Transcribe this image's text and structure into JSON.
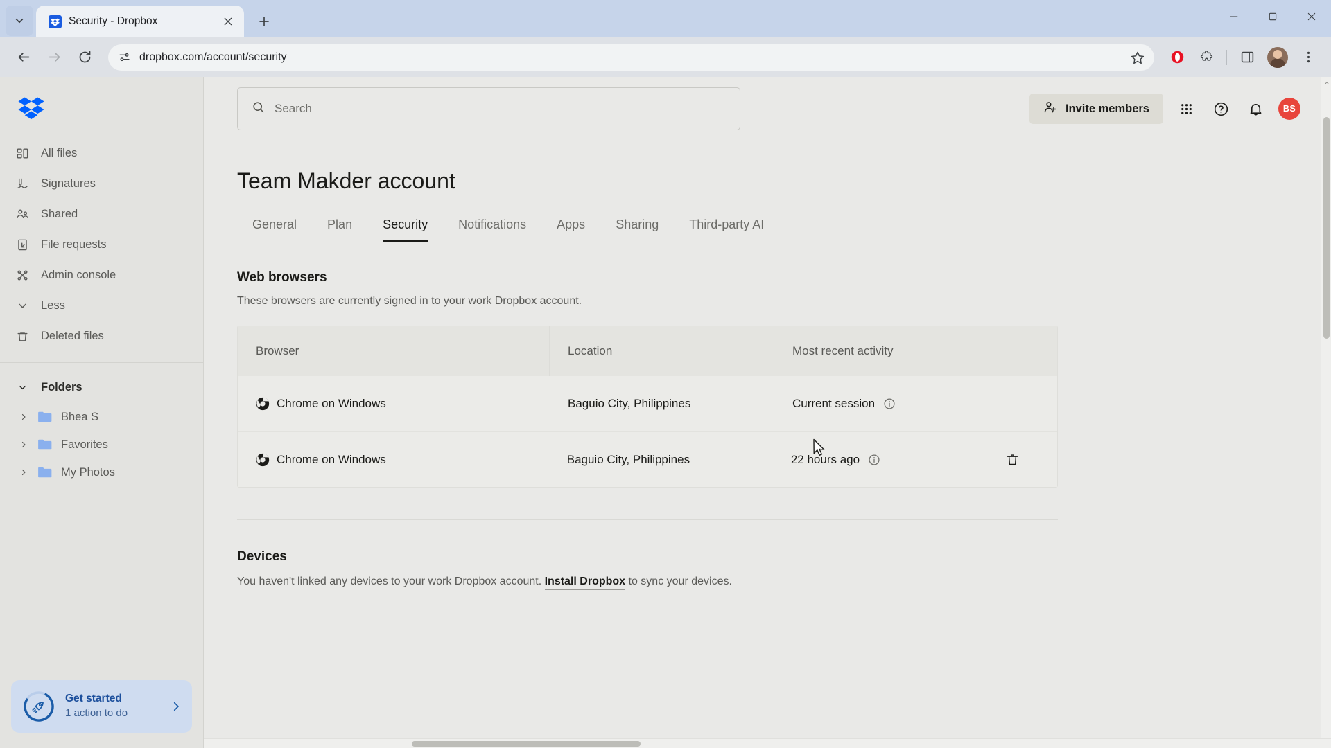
{
  "browser": {
    "tab": {
      "title": "Security - Dropbox",
      "favicon": "dropbox-icon",
      "close": "close-icon"
    },
    "tab_list_button": "tab-search-icon",
    "new_tab_button": "plus-icon",
    "window_controls": {
      "minimize": "minimize-icon",
      "maximize": "maximize-icon",
      "close": "close-icon"
    },
    "nav": {
      "back": "back-arrow-icon",
      "forward": "forward-arrow-icon",
      "reload": "reload-icon"
    },
    "omnibox": {
      "url": "dropbox.com/account/security",
      "site_info_icon": "site-settings-icon",
      "bookmark_icon": "star-icon"
    },
    "toolbar_icons": [
      "opera-extension-icon",
      "extensions-icon",
      "side-panel-icon",
      "profile-avatar",
      "chrome-menu-icon"
    ]
  },
  "sidebar": {
    "logo": "dropbox-logo",
    "items": [
      {
        "label": "All files",
        "icon": "all-files-icon"
      },
      {
        "label": "Signatures",
        "icon": "signature-icon"
      },
      {
        "label": "Shared",
        "icon": "shared-users-icon"
      },
      {
        "label": "File requests",
        "icon": "file-request-icon"
      },
      {
        "label": "Admin console",
        "icon": "admin-console-icon"
      },
      {
        "label": "Less",
        "icon": "chevron-down-icon"
      },
      {
        "label": "Deleted files",
        "icon": "trash-icon"
      }
    ],
    "folders_section": {
      "label": "Folders",
      "icon": "chevron-down-icon"
    },
    "folders": [
      {
        "label": "Bhea S",
        "icon": "folder-icon",
        "chevron": "chevron-right-icon"
      },
      {
        "label": "Favorites",
        "icon": "folder-icon",
        "chevron": "chevron-right-icon"
      },
      {
        "label": "My Photos",
        "icon": "folder-icon",
        "chevron": "chevron-right-icon"
      }
    ],
    "get_started": {
      "title": "Get started",
      "subtitle": "1 action to do",
      "icon": "rocket-icon",
      "chevron": "chevron-right-icon",
      "progress_percent": 75
    }
  },
  "header": {
    "search_placeholder": "Search",
    "search_value": "",
    "search_icon": "search-icon",
    "invite_label": "Invite members",
    "invite_icon": "add-person-icon",
    "apps_grid_icon": "apps-grid-icon",
    "help_icon": "help-circle-icon",
    "notifications_icon": "bell-icon",
    "avatar_initials": "BS",
    "avatar_color": "#e8453c"
  },
  "page": {
    "title": "Team Makder account",
    "tabs": [
      {
        "label": "General",
        "active": false
      },
      {
        "label": "Plan",
        "active": false
      },
      {
        "label": "Security",
        "active": true
      },
      {
        "label": "Notifications",
        "active": false
      },
      {
        "label": "Apps",
        "active": false
      },
      {
        "label": "Sharing",
        "active": false
      },
      {
        "label": "Third-party AI",
        "active": false
      }
    ],
    "web_browsers": {
      "title": "Web browsers",
      "subtitle": "These browsers are currently signed in to your work Dropbox account.",
      "columns": [
        "Browser",
        "Location",
        "Most recent activity",
        ""
      ],
      "rows": [
        {
          "browser": "Chrome on Windows",
          "browser_icon": "chrome-icon",
          "location": "Baguio City, Philippines",
          "activity": "Current session",
          "info_icon": "info-circle-icon",
          "delete_icon": ""
        },
        {
          "browser": "Chrome on Windows",
          "browser_icon": "chrome-icon",
          "location": "Baguio City, Philippines",
          "activity": "22 hours ago",
          "info_icon": "info-circle-icon",
          "delete_icon": "trash-icon"
        }
      ]
    },
    "devices": {
      "title": "Devices",
      "text_before": "You haven't linked any devices to your work Dropbox account. ",
      "link": "Install Dropbox",
      "text_after": " to sync your devices."
    }
  }
}
